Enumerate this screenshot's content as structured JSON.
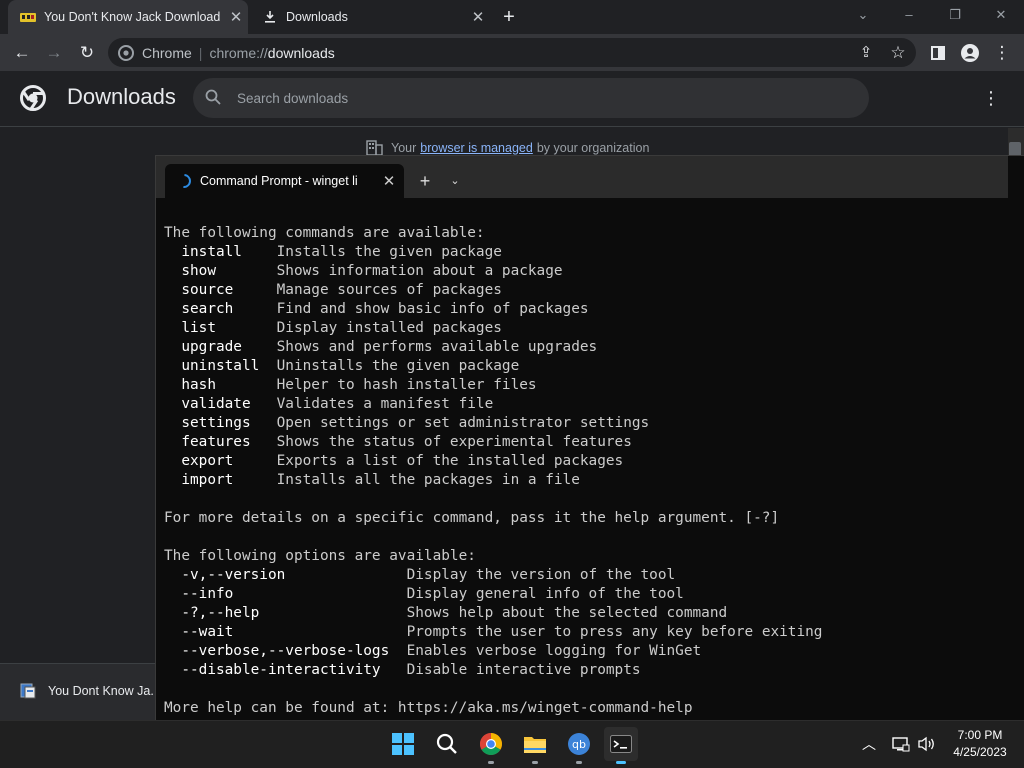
{
  "browser": {
    "tabs": [
      {
        "title": "You Don't Know Jack Download |",
        "favicon": "yellow-game-icon"
      },
      {
        "title": "Downloads",
        "favicon": "download-icon"
      }
    ],
    "window_controls": [
      "chevron-down-icon",
      "minimize-icon",
      "restore-icon",
      "close-icon"
    ],
    "omnibox": {
      "site_label": "Chrome",
      "url_scheme": "chrome://",
      "url_host": "downloads"
    },
    "toolbar_icons": [
      "share-icon",
      "star-icon",
      "sidepanel-icon",
      "profile-icon",
      "menu-icon"
    ]
  },
  "downloads_page": {
    "title": "Downloads",
    "search_placeholder": "Search downloads",
    "managed_notice": {
      "prefix": "Your",
      "link": "browser is managed",
      "suffix": "by your organization"
    },
    "items": [
      {
        "name": "You Dont Know Ja..."
      }
    ]
  },
  "terminal": {
    "tab_title": "Command Prompt - winget  li",
    "lines": [
      {
        "text": "The following commands are available:"
      },
      {
        "cmd": "install",
        "desc": "Installs the given package"
      },
      {
        "cmd": "show",
        "desc": "Shows information about a package"
      },
      {
        "cmd": "source",
        "desc": "Manage sources of packages"
      },
      {
        "cmd": "search",
        "desc": "Find and show basic info of packages"
      },
      {
        "cmd": "list",
        "desc": "Display installed packages"
      },
      {
        "cmd": "upgrade",
        "desc": "Shows and performs available upgrades"
      },
      {
        "cmd": "uninstall",
        "desc": "Uninstalls the given package"
      },
      {
        "cmd": "hash",
        "desc": "Helper to hash installer files"
      },
      {
        "cmd": "validate",
        "desc": "Validates a manifest file"
      },
      {
        "cmd": "settings",
        "desc": "Open settings or set administrator settings"
      },
      {
        "cmd": "features",
        "desc": "Shows the status of experimental features"
      },
      {
        "cmd": "export",
        "desc": "Exports a list of the installed packages"
      },
      {
        "cmd": "import",
        "desc": "Installs all the packages in a file"
      },
      {
        "text": ""
      },
      {
        "text": "For more details on a specific command, pass it the help argument. [-?]"
      },
      {
        "text": ""
      },
      {
        "text": "The following options are available:"
      },
      {
        "opt": "-v,--version",
        "desc": "Display the version of the tool"
      },
      {
        "opt": "--info",
        "desc": "Display general info of the tool"
      },
      {
        "opt": "-?,--help",
        "desc": "Shows help about the selected command"
      },
      {
        "opt": "--wait",
        "desc": "Prompts the user to press any key before exiting"
      },
      {
        "opt": "--verbose,--verbose-logs",
        "desc": "Enables verbose logging for WinGet"
      },
      {
        "opt": "--disable-interactivity",
        "desc": "Disable interactive prompts"
      },
      {
        "text": ""
      },
      {
        "text": "More help can be found at: https://aka.ms/winget-command-help"
      }
    ]
  },
  "taskbar": {
    "apps": [
      "windows-start-icon",
      "search-icon",
      "chrome-icon",
      "file-explorer-icon",
      "qbittorrent-icon",
      "terminal-icon"
    ],
    "tray_icons": [
      "chevron-up-icon",
      "network-icon",
      "volume-icon"
    ],
    "clock": {
      "time": "7:00 PM",
      "date": "4/25/2023"
    }
  }
}
